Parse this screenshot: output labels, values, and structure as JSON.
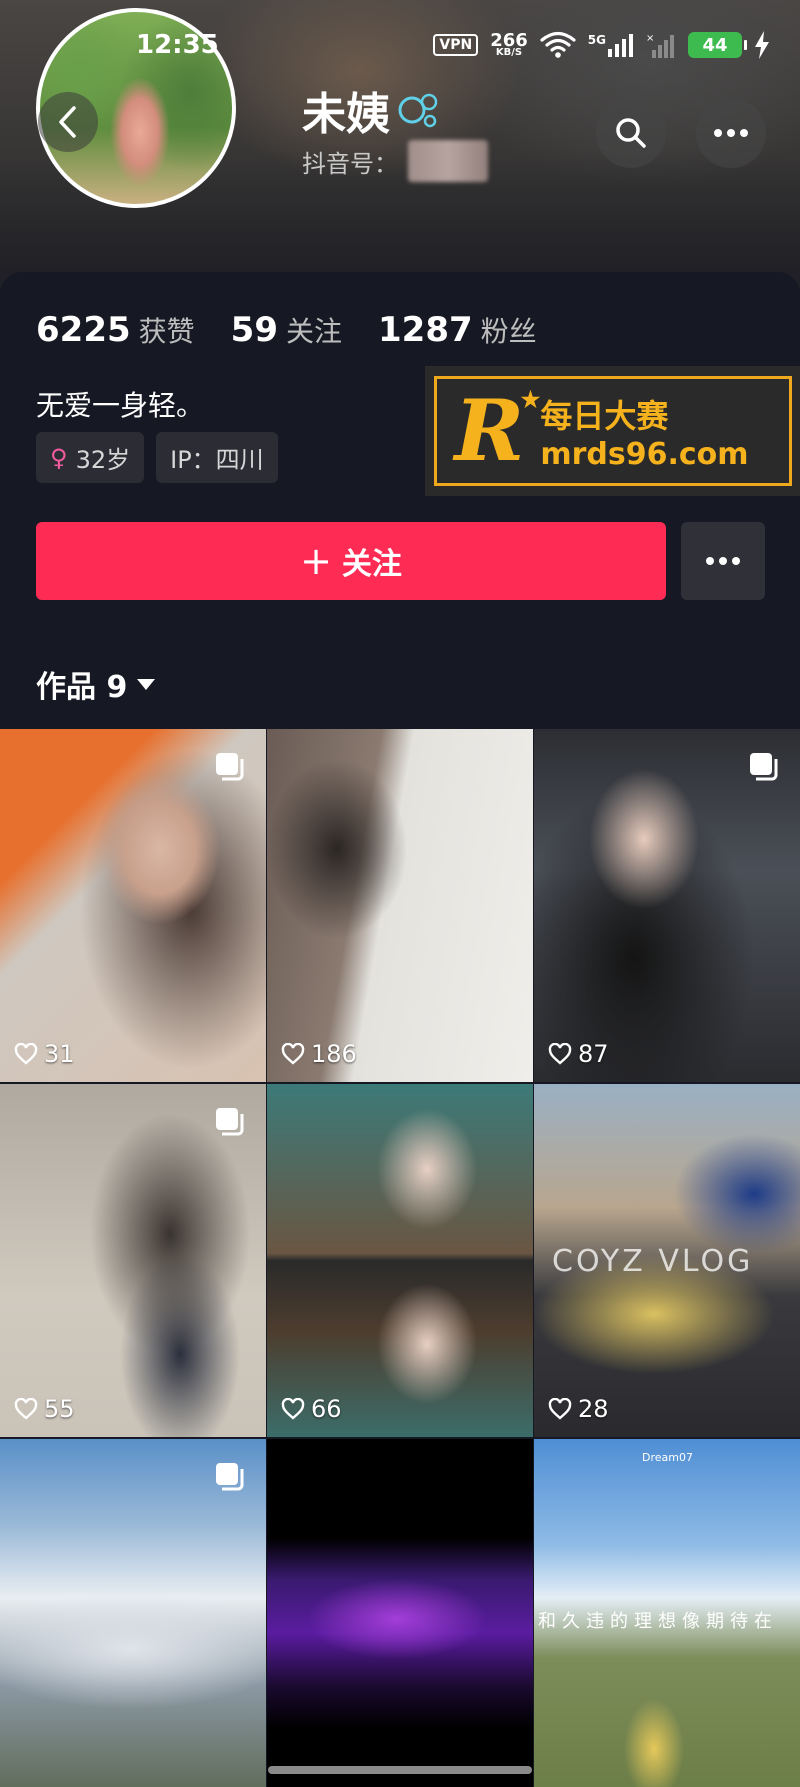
{
  "status_bar": {
    "time": "12:35",
    "vpn": "VPN",
    "speed_value": "266",
    "speed_unit": "KB/S",
    "network": "5G",
    "battery": "44"
  },
  "profile": {
    "name": "未姨",
    "douyin_id_label": "抖音号：",
    "stats": [
      {
        "value": "6225",
        "label": "获赞"
      },
      {
        "value": "59",
        "label": "关注"
      },
      {
        "value": "1287",
        "label": "粉丝"
      }
    ],
    "bio": "无爱一身轻。",
    "tags": {
      "age": "32岁",
      "ip": "IP：四川"
    },
    "follow_label": "关注",
    "works_tab": "作品 9"
  },
  "watermark": {
    "logo_letter": "R",
    "cn_text": "每日大赛",
    "url": "mrds96.com"
  },
  "videos": [
    {
      "likes": "31",
      "multi": true
    },
    {
      "likes": "186",
      "multi": false
    },
    {
      "likes": "87",
      "multi": true
    },
    {
      "likes": "55",
      "multi": true
    },
    {
      "likes": "66",
      "multi": false
    },
    {
      "likes": "28",
      "multi": false,
      "overlay_text": "COYZ VLOG"
    },
    {
      "likes": "",
      "multi": true
    },
    {
      "likes": "",
      "multi": false
    },
    {
      "likes": "",
      "multi": false,
      "overlay_text": "和久违的理想像期待在",
      "small_text": "Dream07"
    }
  ],
  "colors": {
    "background": "#161823",
    "follow_button": "#fe2c55",
    "watermark_gold": "#f6b21d",
    "battery_green": "#3dbb4e",
    "female_icon": "#f15a9c"
  },
  "icons": [
    "back-arrow-icon",
    "search-icon",
    "more-dots-icon",
    "bubble-badge-icon",
    "female-icon",
    "heart-icon",
    "multi-image-icon",
    "wifi-icon",
    "signal-icon",
    "charging-icon"
  ]
}
